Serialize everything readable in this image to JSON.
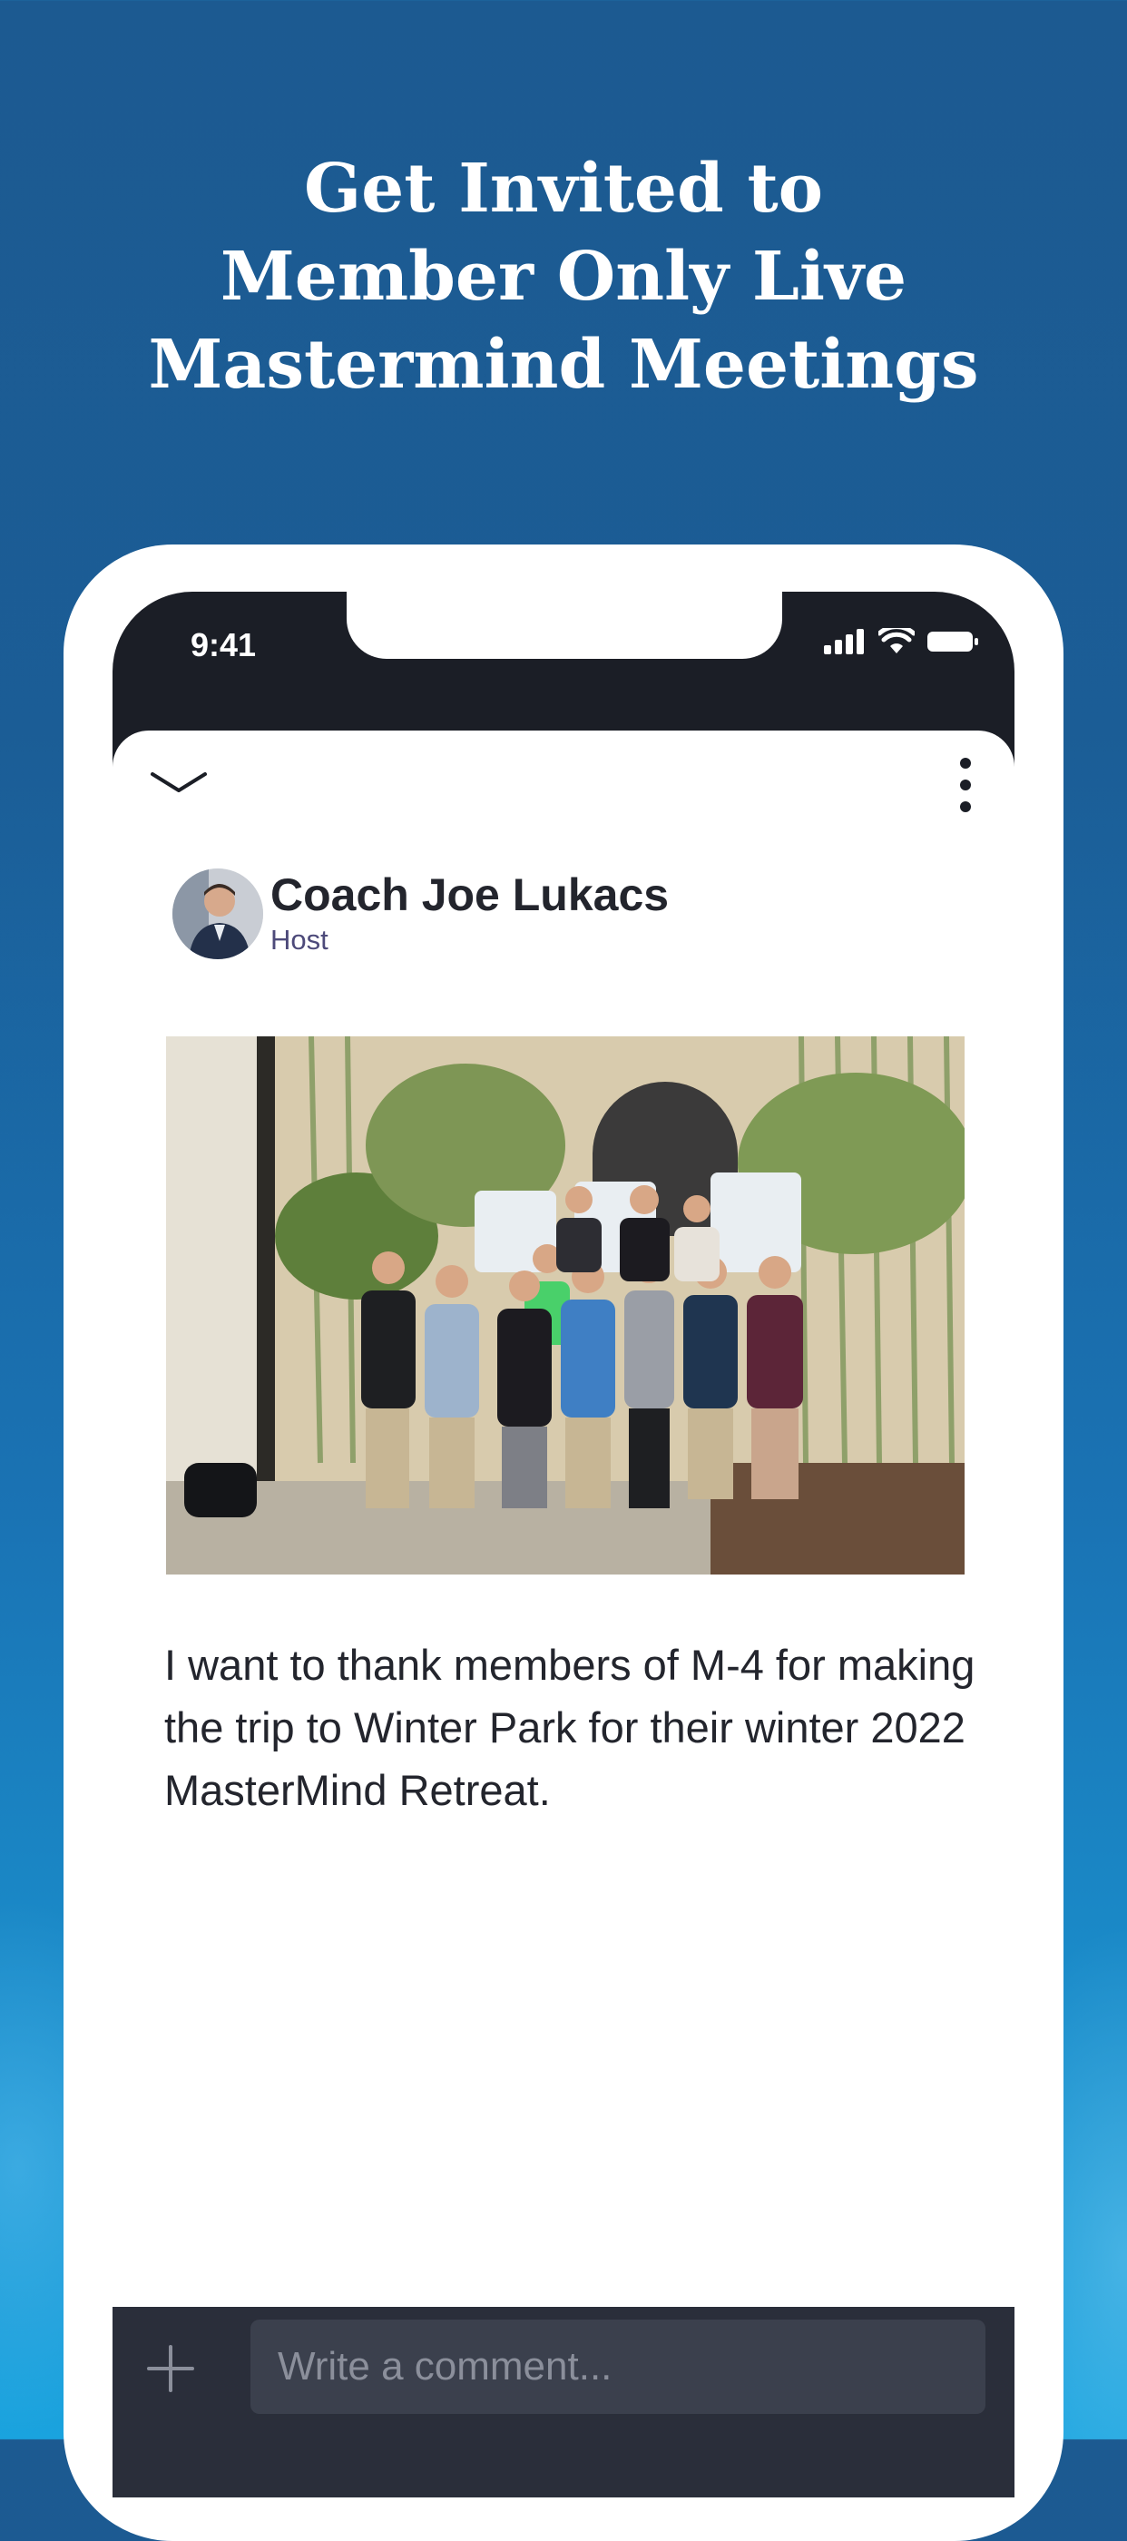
{
  "promo": {
    "headline_lines": [
      "Get Invited to",
      "Member Only Live",
      "Mastermind Meetings"
    ]
  },
  "status_bar": {
    "time": "9:41",
    "icons": [
      "signal-icon",
      "wifi-icon",
      "battery-icon"
    ]
  },
  "toolbar": {
    "collapse_icon": "chevron-down-icon",
    "more_icon": "more-vertical-icon"
  },
  "post": {
    "author_name": "Coach Joe Lukacs",
    "author_role": "Host",
    "image_description_icon": "group-photo",
    "body": "I want to thank members of M-4 for making the trip to Winter Park for their winter 2022 MasterMind Retreat."
  },
  "comment_bar": {
    "add_icon": "plus-icon",
    "placeholder": "Write a comment..."
  },
  "colors": {
    "background_top": "#1c5a91",
    "background_bottom": "#1aa3de",
    "phone_dark": "#1b1e26",
    "comment_bar": "#2a2e3a",
    "role_text": "#4d4a7a"
  }
}
